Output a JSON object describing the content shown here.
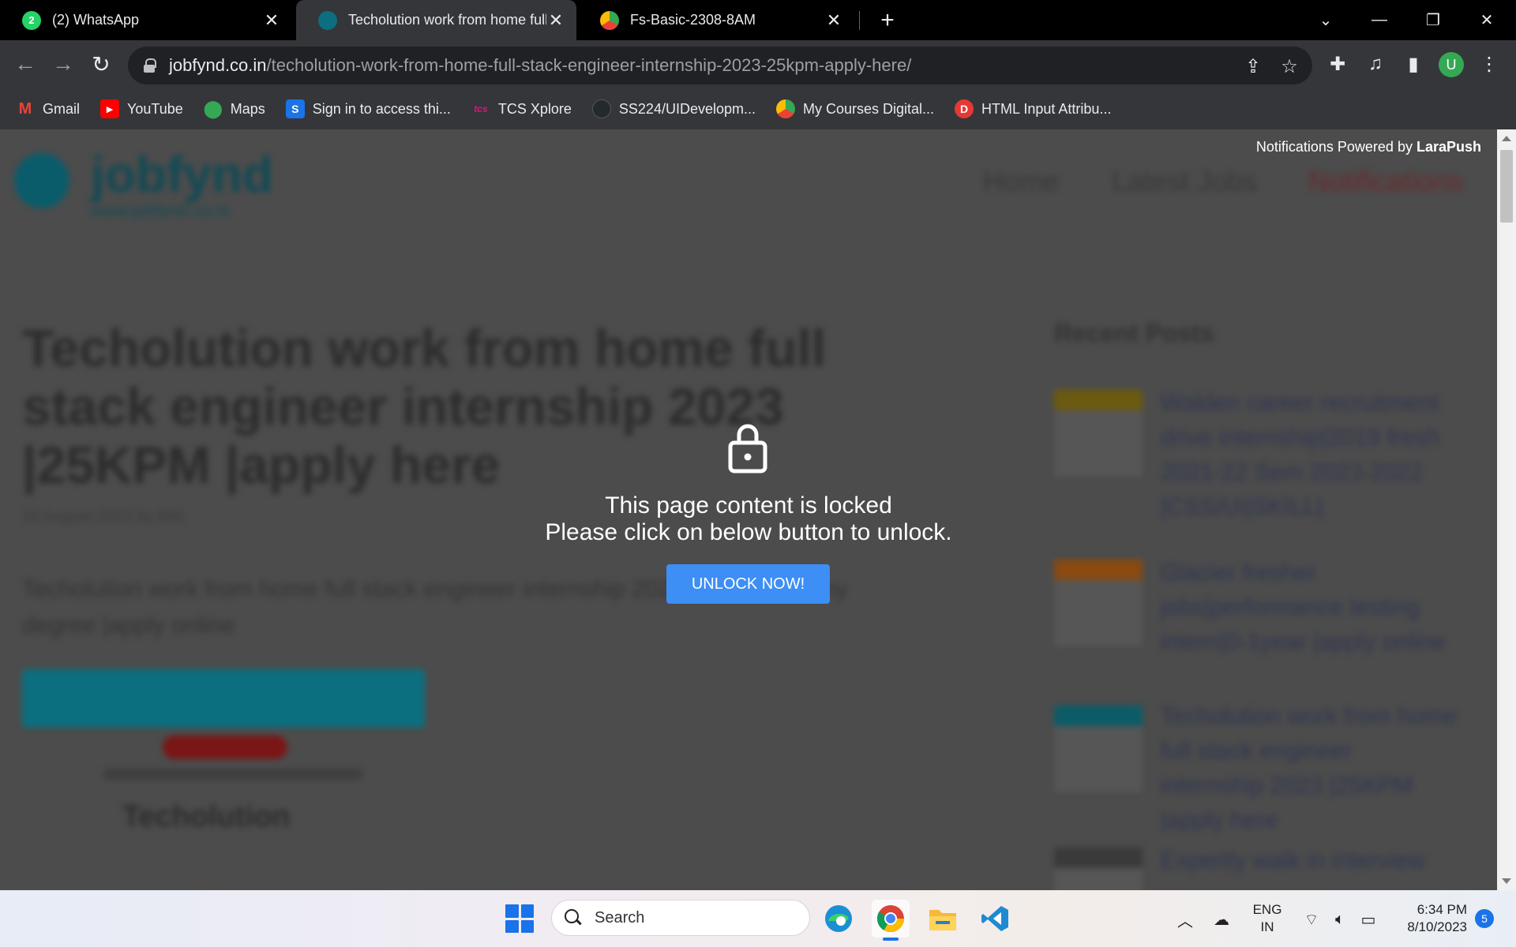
{
  "tabs": [
    {
      "title": "(2) WhatsApp",
      "favicon": "whatsapp-icon",
      "badge": "2",
      "active": false
    },
    {
      "title": "Techolution work from home full",
      "favicon": "jobfynd-icon",
      "active": true
    },
    {
      "title": "Fs-Basic-2308-8AM",
      "favicon": "course-icon",
      "active": false
    }
  ],
  "address_bar": {
    "host": "jobfynd.co.in",
    "path": "/techolution-work-from-home-full-stack-engineer-internship-2023-25kpm-apply-here/"
  },
  "profile": {
    "initial": "U"
  },
  "bookmarks": [
    {
      "label": "Gmail",
      "icon": "gmail-icon",
      "color": "#ea4335"
    },
    {
      "label": "YouTube",
      "icon": "youtube-icon",
      "color": "#ff0000"
    },
    {
      "label": "Maps",
      "icon": "maps-icon",
      "color": "#34a853"
    },
    {
      "label": "Sign in to access thi...",
      "icon": "s-icon",
      "color": "#1a73e8",
      "glyph": "S"
    },
    {
      "label": "TCS Xplore",
      "icon": "tcs-icon",
      "color": "#e3137b",
      "glyph": "tcs"
    },
    {
      "label": "SS224/UIDevelopm...",
      "icon": "github-icon",
      "color": "#24292e"
    },
    {
      "label": "My Courses Digital...",
      "icon": "course-icon",
      "color": "#f4b400"
    },
    {
      "label": "HTML Input Attribu...",
      "icon": "d-icon",
      "color": "#e53935",
      "glyph": "D"
    }
  ],
  "page": {
    "notification_bar": {
      "prefix": "Notifications Powered by ",
      "brand": "LaraPush"
    },
    "logo": {
      "name": "jobfynd",
      "url": "www.jobfynd.co.in"
    },
    "nav": {
      "home": "Home",
      "latest": "Latest Jobs",
      "notifications": "Notifications"
    },
    "headline": "Techolution work from home full stack engineer internship 2023 |25KPM |apply here",
    "meta": "10 August 2023 by Bkb",
    "excerpt": "Techolution work from home full stack engineer internship 2023 2022 2024 any degree |apply online",
    "company_logo": "Techolution",
    "sidebar": {
      "heading": "Recent Posts",
      "posts": [
        {
          "title": "Walden career recruitment drive internship|2019 fresh 2021-22 Sem 2023-2022 |CSS/UI|SKILL|",
          "band": "#6b5a10"
        },
        {
          "title": "Glacier fresher jobs|performance testing intern|0-1year |apply online",
          "band": "#8a4a10"
        },
        {
          "title": "Techolution work from home full stack engineer internship 2023 |25KPM |apply here",
          "band": "#0b5c68"
        },
        {
          "title": "Expertly walk in interview",
          "band": "#3a3a3a"
        }
      ]
    },
    "lock": {
      "line1": "This page content is locked",
      "line2": "Please click on below button to unlock.",
      "button": "UNLOCK NOW!"
    }
  },
  "taskbar": {
    "search_placeholder": "Search",
    "language": {
      "line1": "ENG",
      "line2": "IN"
    },
    "time": "6:34 PM",
    "date": "8/10/2023",
    "notifications_count": "5",
    "apps": [
      "edge-icon",
      "chrome-icon",
      "file-explorer-icon",
      "vscode-icon"
    ]
  }
}
